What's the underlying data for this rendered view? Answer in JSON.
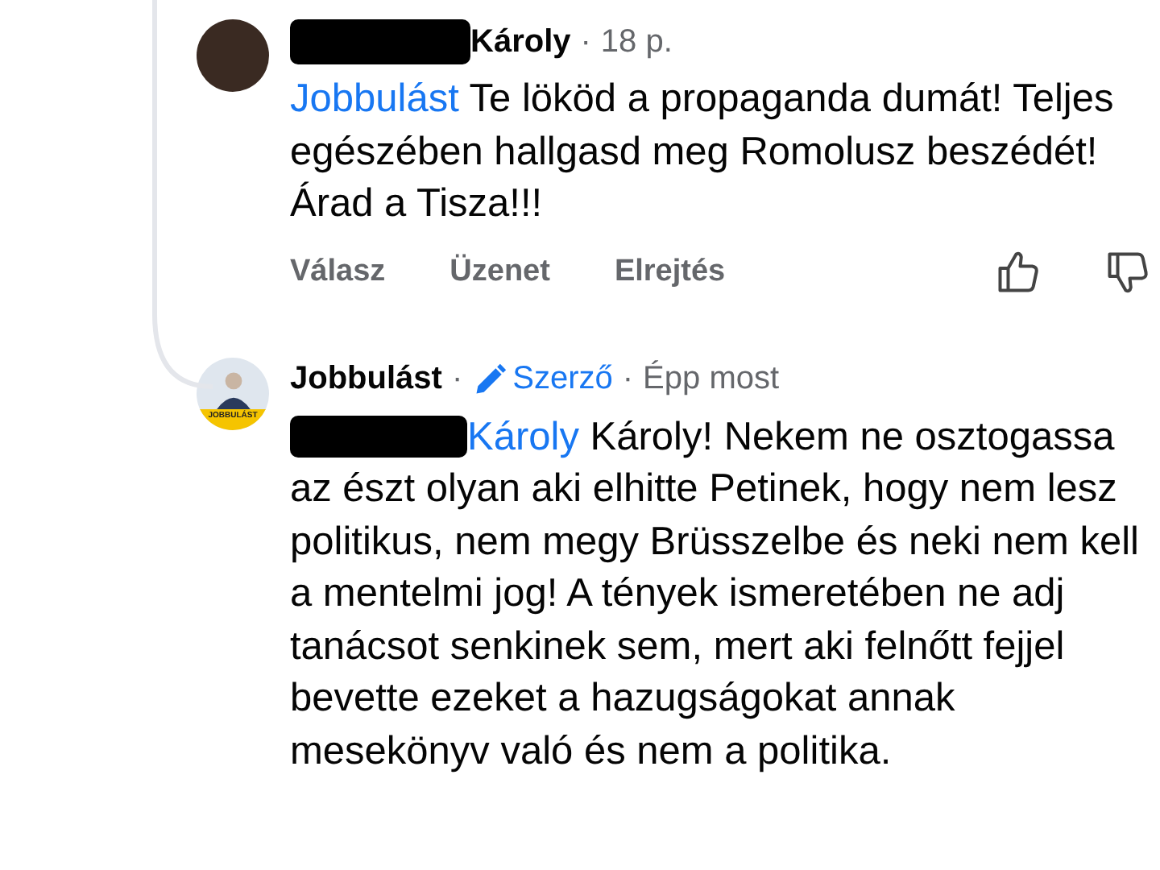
{
  "comments": [
    {
      "kind": "photo",
      "author_redacted": true,
      "author": "Károly",
      "meta": [
        {
          "kind": "sep",
          "text": "·"
        },
        {
          "kind": "time",
          "text": "18 p."
        }
      ],
      "mention": "Jobbulást",
      "mention_redacted": false,
      "text": "Te lököd a propaganda dumát! Teljes egészében hallgasd meg Romolusz beszédét! Árad a Tisza!!!",
      "actions": [
        "Válasz",
        "Üzenet",
        "Elrejtés"
      ]
    },
    {
      "kind": "logo",
      "avatar_text": "JOBBULÁST",
      "author_redacted": false,
      "author": "Jobbulást",
      "meta": [
        {
          "kind": "sep",
          "text": "·"
        },
        {
          "kind": "badge",
          "text": "Szerző"
        },
        {
          "kind": "sep",
          "text": "·"
        },
        {
          "kind": "time",
          "text": "Épp most"
        }
      ],
      "mention": "Károly",
      "mention_redacted": true,
      "text": "Károly! Nekem ne osztogassa az észt olyan aki elhitte Petinek, hogy nem lesz politikus, nem megy Brüsszelbe és neki nem kell a mentelmi jog! A tények ismeretében ne adj tanácsot senkinek sem, mert aki felnőtt fejjel bevette ezeket a hazugságokat annak mesekönyv való és nem a politika."
    }
  ]
}
